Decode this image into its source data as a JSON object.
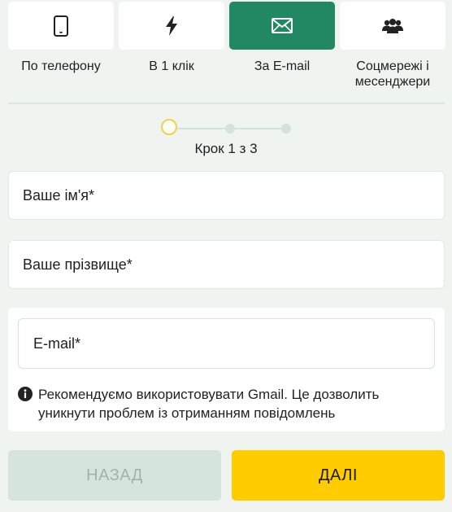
{
  "tabs": [
    {
      "label": "По телефону",
      "icon": "phone-icon",
      "active": false
    },
    {
      "label": "В 1 клік",
      "icon": "lightning-icon",
      "active": false
    },
    {
      "label": "За E-mail",
      "icon": "envelope-icon",
      "active": true
    },
    {
      "label_line1": "Соцмережі і",
      "label_line2": "месенджери",
      "icon": "users-icon",
      "active": false
    }
  ],
  "stepper": {
    "current": 1,
    "total": 3,
    "caption": "Крок 1 з 3"
  },
  "form": {
    "first_name_placeholder": "Ваше ім'я*",
    "last_name_placeholder": "Ваше прізвище*",
    "email_placeholder": "E-mail*",
    "hint_line1": "Рекомендуємо використовувати Gmail. Це дозволить",
    "hint_line2": "уникнути проблем із отриманням повідомлень"
  },
  "buttons": {
    "back_label": "НАЗАД",
    "next_label": "ДАЛІ"
  },
  "colors": {
    "accent": "#218863",
    "primary_button": "#ffcc00",
    "disabled_button": "#d5e5dc",
    "background": "#eff4f1",
    "step_current": "#f2d04a"
  }
}
